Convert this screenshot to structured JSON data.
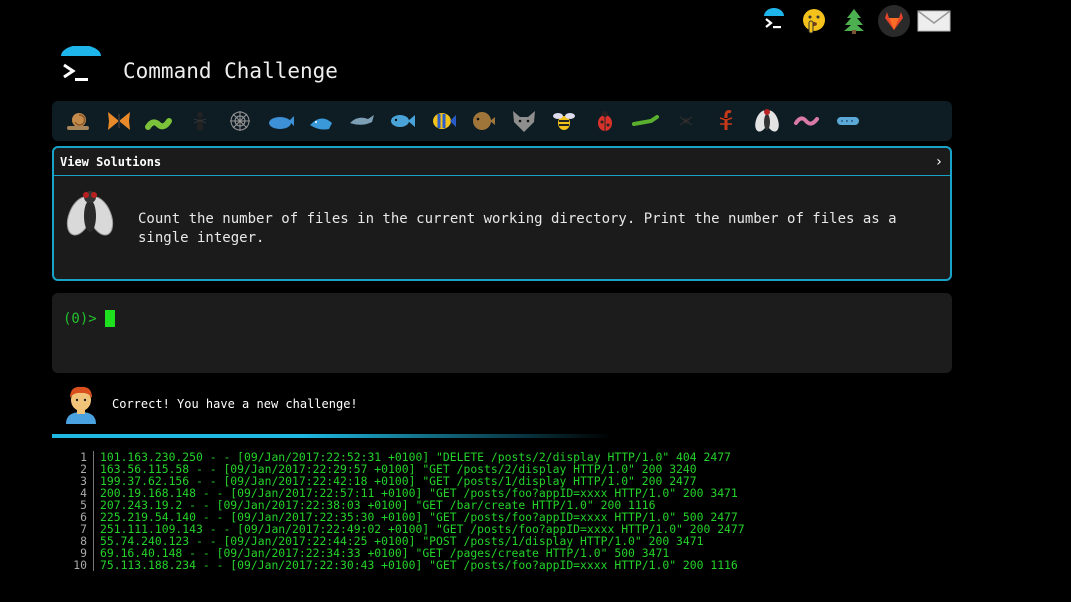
{
  "header": {
    "title": "Command Challenge",
    "top_icons": [
      "terminal-icon",
      "shushing-face-icon",
      "tree-icon",
      "gitlab-icon",
      "mail-icon"
    ]
  },
  "level_bar": {
    "emojis": [
      "snail",
      "butterfly",
      "bug",
      "ant",
      "spider-web",
      "whale",
      "whale-spouting",
      "dolphin",
      "fish",
      "tropical-fish",
      "blowfish",
      "wolf",
      "bee",
      "lady-beetle",
      "cricket",
      "spider",
      "scorpion",
      "fly",
      "worm",
      "microbe"
    ]
  },
  "challenge": {
    "solutions_label": "View Solutions",
    "chevron": "›",
    "text": "Count the number of files in the current working directory. Print the number of files as a single integer."
  },
  "terminal": {
    "prompt": "(0)>"
  },
  "feedback": {
    "message": "Correct! You have a new challenge!",
    "progress": 0.5
  },
  "log": {
    "lines": [
      {
        "n": "1",
        "t": "101.163.230.250 - - [09/Jan/2017:22:52:31 +0100] \"DELETE /posts/2/display HTTP/1.0\" 404 2477"
      },
      {
        "n": "2",
        "t": "163.56.115.58 - - [09/Jan/2017:22:29:57 +0100] \"GET /posts/2/display HTTP/1.0\" 200 3240"
      },
      {
        "n": "3",
        "t": "199.37.62.156 - - [09/Jan/2017:22:42:18 +0100] \"GET /posts/1/display HTTP/1.0\" 200 2477"
      },
      {
        "n": "4",
        "t": "200.19.168.148 - - [09/Jan/2017:22:57:11 +0100] \"GET /posts/foo?appID=xxxx HTTP/1.0\" 200 3471"
      },
      {
        "n": "5",
        "t": "207.243.19.2 - - [09/Jan/2017:22:38:03 +0100] \"GET /bar/create HTTP/1.0\" 200 1116"
      },
      {
        "n": "6",
        "t": "225.219.54.140 - - [09/Jan/2017:22:35:30 +0100] \"GET /posts/foo?appID=xxxx HTTP/1.0\" 500 2477"
      },
      {
        "n": "7",
        "t": "251.111.109.143 - - [09/Jan/2017:22:49:02 +0100] \"GET /posts/foo?appID=xxxx HTTP/1.0\" 200 2477"
      },
      {
        "n": "8",
        "t": "55.74.240.123 - - [09/Jan/2017:22:44:25 +0100] \"POST /posts/1/display HTTP/1.0\" 200 3471"
      },
      {
        "n": "9",
        "t": "69.16.40.148 - - [09/Jan/2017:22:34:33 +0100] \"GET /pages/create HTTP/1.0\" 500 3471"
      },
      {
        "n": "10",
        "t": "75.113.188.234 - - [09/Jan/2017:22:30:43 +0100] \"GET /posts/foo?appID=xxxx HTTP/1.0\" 200 1116"
      }
    ]
  }
}
